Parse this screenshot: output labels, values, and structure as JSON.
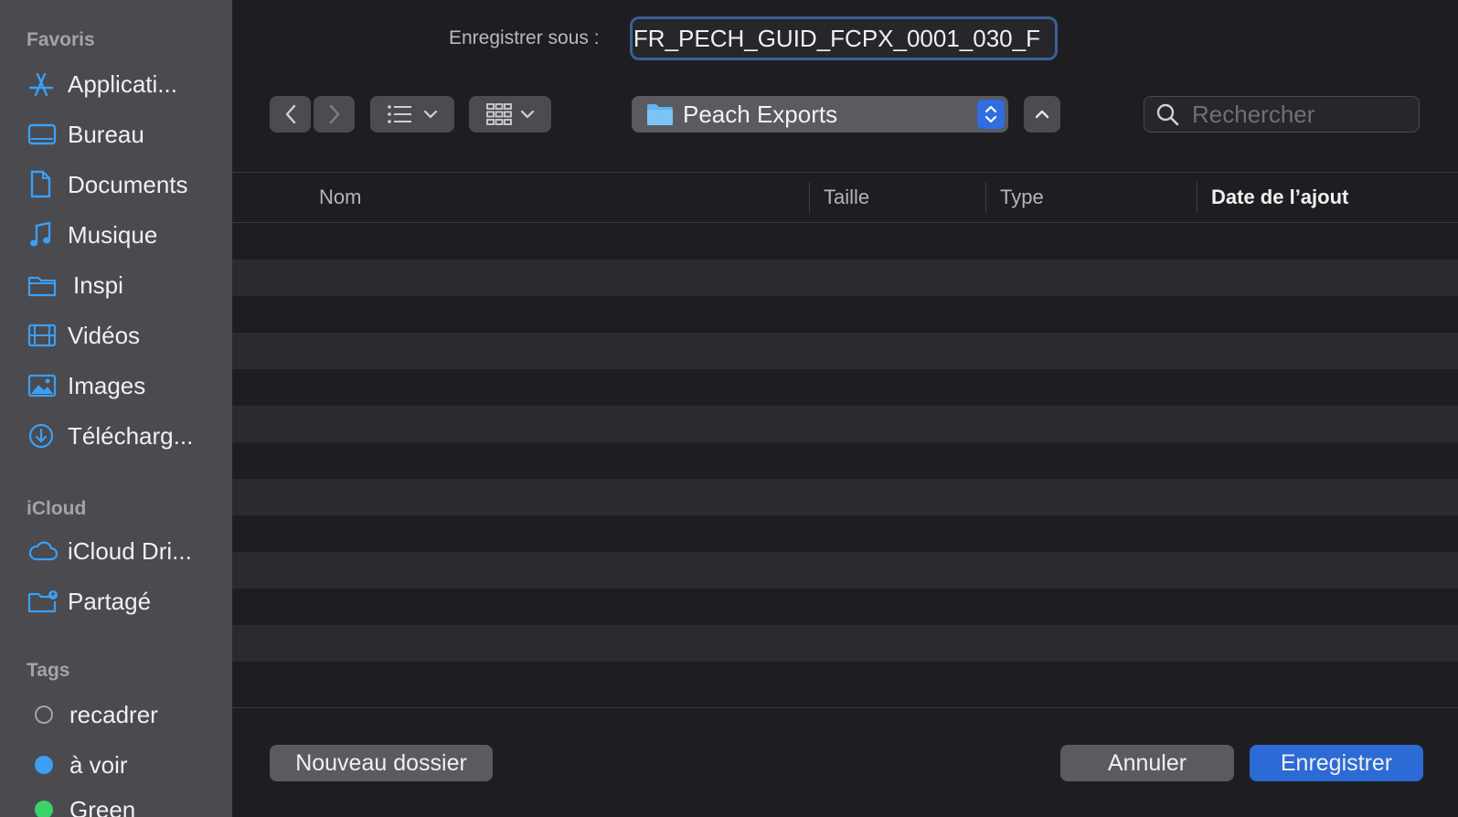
{
  "sidebar": {
    "favorites_title": "Favoris",
    "favorites": [
      {
        "label": "Applicati...",
        "icon": "applications-icon"
      },
      {
        "label": "Bureau",
        "icon": "desktop-icon"
      },
      {
        "label": "Documents",
        "icon": "document-icon"
      },
      {
        "label": "Musique",
        "icon": "music-icon"
      },
      {
        "label": "Inspi",
        "icon": "folder-icon"
      },
      {
        "label": "Vidéos",
        "icon": "film-icon"
      },
      {
        "label": "Images",
        "icon": "photo-icon"
      },
      {
        "label": "Télécharg...",
        "icon": "download-icon"
      }
    ],
    "icloud_title": "iCloud",
    "icloud": [
      {
        "label": "iCloud Dri...",
        "icon": "cloud-icon"
      },
      {
        "label": "Partagé",
        "icon": "shared-folder-icon"
      }
    ],
    "tags_title": "Tags",
    "tags": [
      {
        "label": "recadrer",
        "color": "none"
      },
      {
        "label": "à voir",
        "color": "#3a9ff5"
      },
      {
        "label": "Green",
        "color": "#3bd26a"
      }
    ]
  },
  "save": {
    "label": "Enregistrer sous :",
    "filename": "FR_PECH_GUID_FCPX_0001_030_F"
  },
  "toolbar": {
    "location": "Peach Exports",
    "search_placeholder": "Rechercher"
  },
  "list": {
    "columns": [
      "Nom",
      "Taille",
      "Type",
      "Date de l’ajout"
    ]
  },
  "buttons": {
    "new_folder": "Nouveau dossier",
    "cancel": "Annuler",
    "save": "Enregistrer"
  },
  "colors": {
    "accent": "#2c6ad6",
    "sidebar_icon": "#3a9ff5"
  }
}
